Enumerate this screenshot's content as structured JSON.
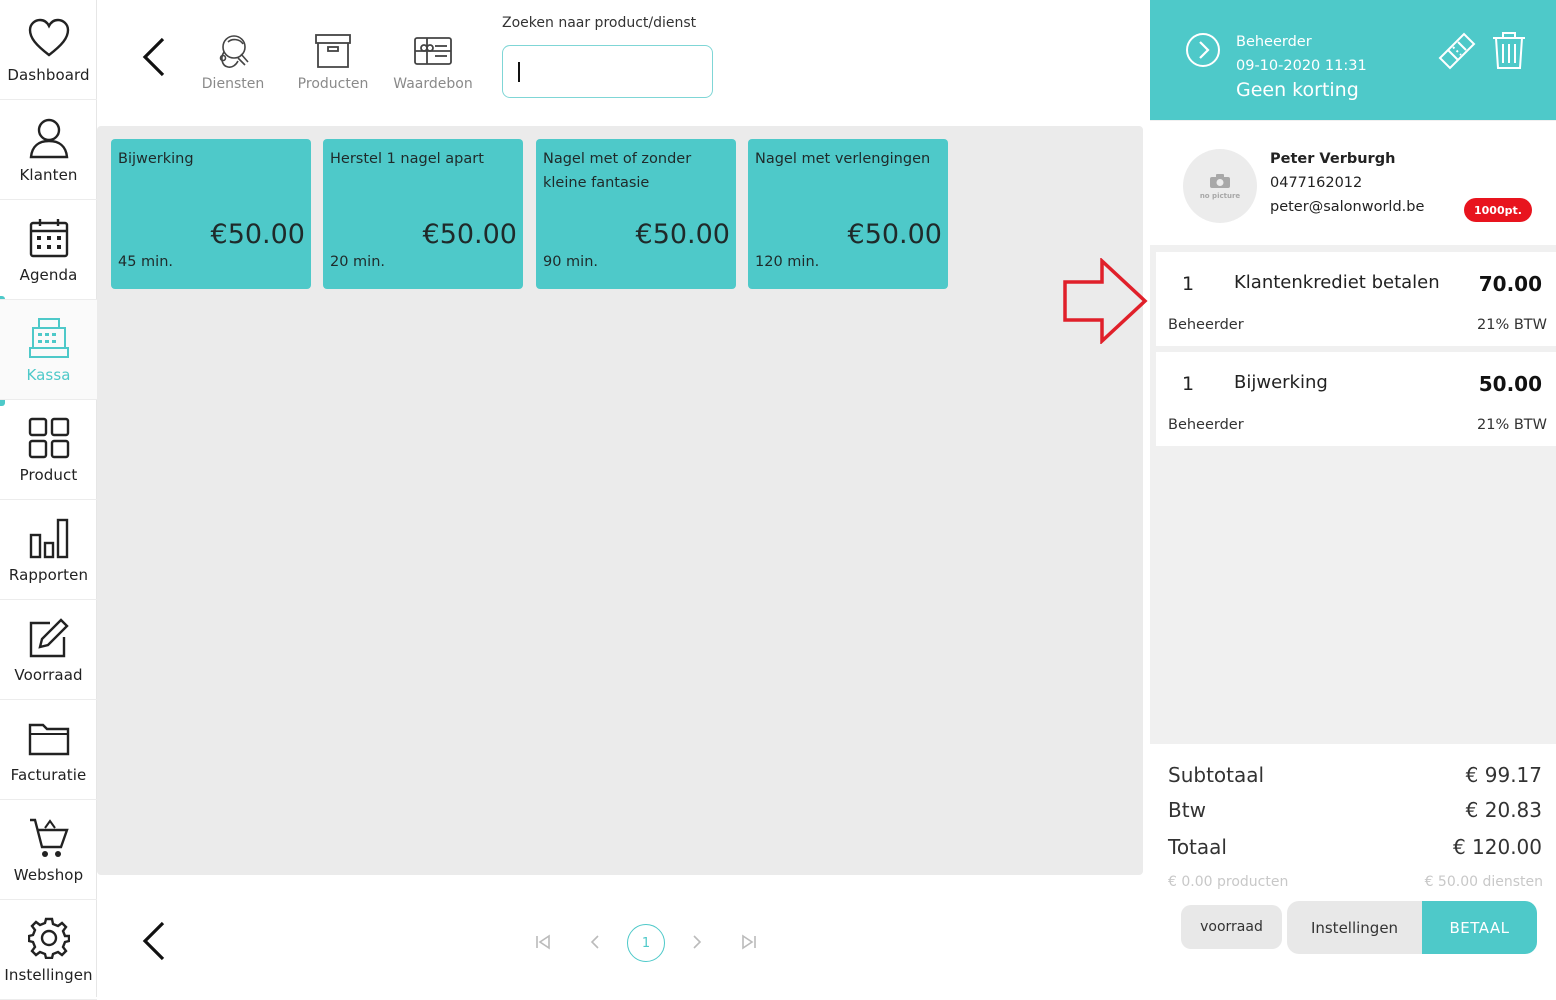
{
  "sidebar": {
    "items": [
      {
        "label": "Dashboard",
        "icon": "heart-icon"
      },
      {
        "label": "Klanten",
        "icon": "user-icon"
      },
      {
        "label": "Agenda",
        "icon": "calendar-icon"
      },
      {
        "label": "Kassa",
        "icon": "cash-register-icon",
        "active": true
      },
      {
        "label": "Product",
        "icon": "grid-icon"
      },
      {
        "label": "Rapporten",
        "icon": "bar-chart-icon"
      },
      {
        "label": "Voorraad",
        "icon": "edit-icon"
      },
      {
        "label": "Facturatie",
        "icon": "folder-icon"
      },
      {
        "label": "Webshop",
        "icon": "cart-icon"
      },
      {
        "label": "Instellingen",
        "icon": "gear-icon"
      }
    ]
  },
  "categories": [
    {
      "label": "Diensten",
      "icon": "hairdresser-icon"
    },
    {
      "label": "Producten",
      "icon": "box-icon"
    },
    {
      "label": "Waardebon",
      "icon": "gift-card-icon"
    }
  ],
  "search": {
    "label": "Zoeken naar product/dienst",
    "value": ""
  },
  "tiles": [
    {
      "name": "Bijwerking",
      "price": "€50.00",
      "duration": "45 min."
    },
    {
      "name": "Herstel 1 nagel apart",
      "price": "€50.00",
      "duration": "20 min."
    },
    {
      "name": "Nagel met of zonder kleine fantasie",
      "price": "€50.00",
      "duration": "90 min."
    },
    {
      "name": "Nagel met verlengingen",
      "price": "€50.00",
      "duration": "120 min."
    }
  ],
  "pagination": {
    "current": "1"
  },
  "ticket": {
    "employee": "Beheerder",
    "datetime": "09-10-2020 11:31",
    "discount": "Geen korting"
  },
  "customer": {
    "name": "Peter Verburgh",
    "phone": "0477162012",
    "email": "peter@salonworld.be",
    "points": "1000pt.",
    "avatar_text": "no picture"
  },
  "lines": [
    {
      "qty": "1",
      "name": "Klantenkrediet betalen",
      "price": "70.00",
      "employee": "Beheerder",
      "vat": "21% BTW"
    },
    {
      "qty": "1",
      "name": "Bijwerking",
      "price": "50.00",
      "employee": "Beheerder",
      "vat": "21% BTW"
    }
  ],
  "totals": {
    "subtotal_label": "Subtotaal",
    "subtotal": "€ 99.17",
    "vat_label": "Btw",
    "vat": "€ 20.83",
    "total_label": "Totaal",
    "total": "€ 120.00",
    "products": "€ 0.00 producten",
    "services": "€ 50.00 diensten"
  },
  "buttons": {
    "stock": "voorraad",
    "settings": "Instellingen",
    "pay": "BETAAL"
  },
  "colors": {
    "accent": "#4ec9c9",
    "badge": "#e8141e",
    "arrow": "#e0202a"
  }
}
